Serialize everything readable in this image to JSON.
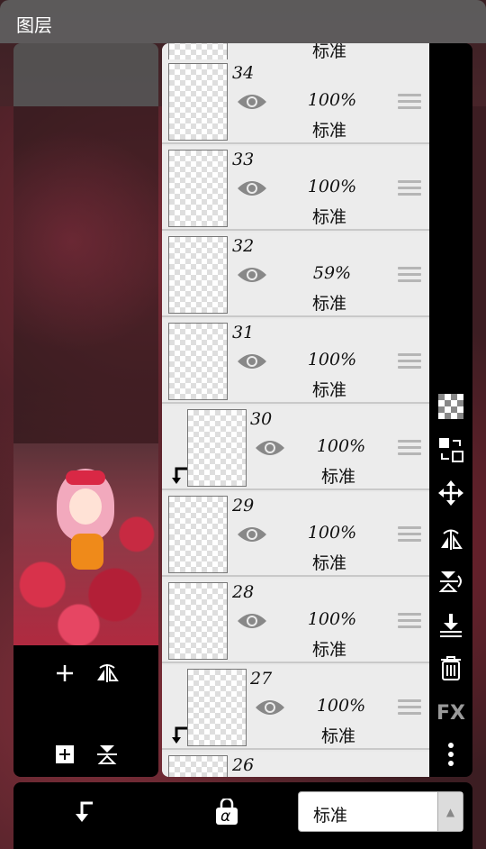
{
  "title": "图层",
  "layers": [
    {
      "num": "",
      "opacity": "",
      "mode": "标准",
      "clipped": false
    },
    {
      "num": "34",
      "opacity": "100%",
      "mode": "标准",
      "clipped": false
    },
    {
      "num": "33",
      "opacity": "100%",
      "mode": "标准",
      "clipped": false
    },
    {
      "num": "32",
      "opacity": "59%",
      "mode": "标准",
      "clipped": false
    },
    {
      "num": "31",
      "opacity": "100%",
      "mode": "标准",
      "clipped": false
    },
    {
      "num": "30",
      "opacity": "100%",
      "mode": "标准",
      "clipped": true
    },
    {
      "num": "29",
      "opacity": "100%",
      "mode": "标准",
      "clipped": false
    },
    {
      "num": "28",
      "opacity": "100%",
      "mode": "标准",
      "clipped": false
    },
    {
      "num": "27",
      "opacity": "100%",
      "mode": "标准",
      "clipped": true
    },
    {
      "num": "26",
      "opacity": "",
      "mode": "",
      "clipped": false
    }
  ],
  "sidebar": {
    "fx_label": "FX"
  },
  "bottom": {
    "blend_mode": "标准",
    "alpha_lock_label": "α"
  },
  "colors": {
    "panel_gray": "#5f5f5f",
    "toolbar_black": "#000000",
    "row_bg": "#ececec"
  }
}
